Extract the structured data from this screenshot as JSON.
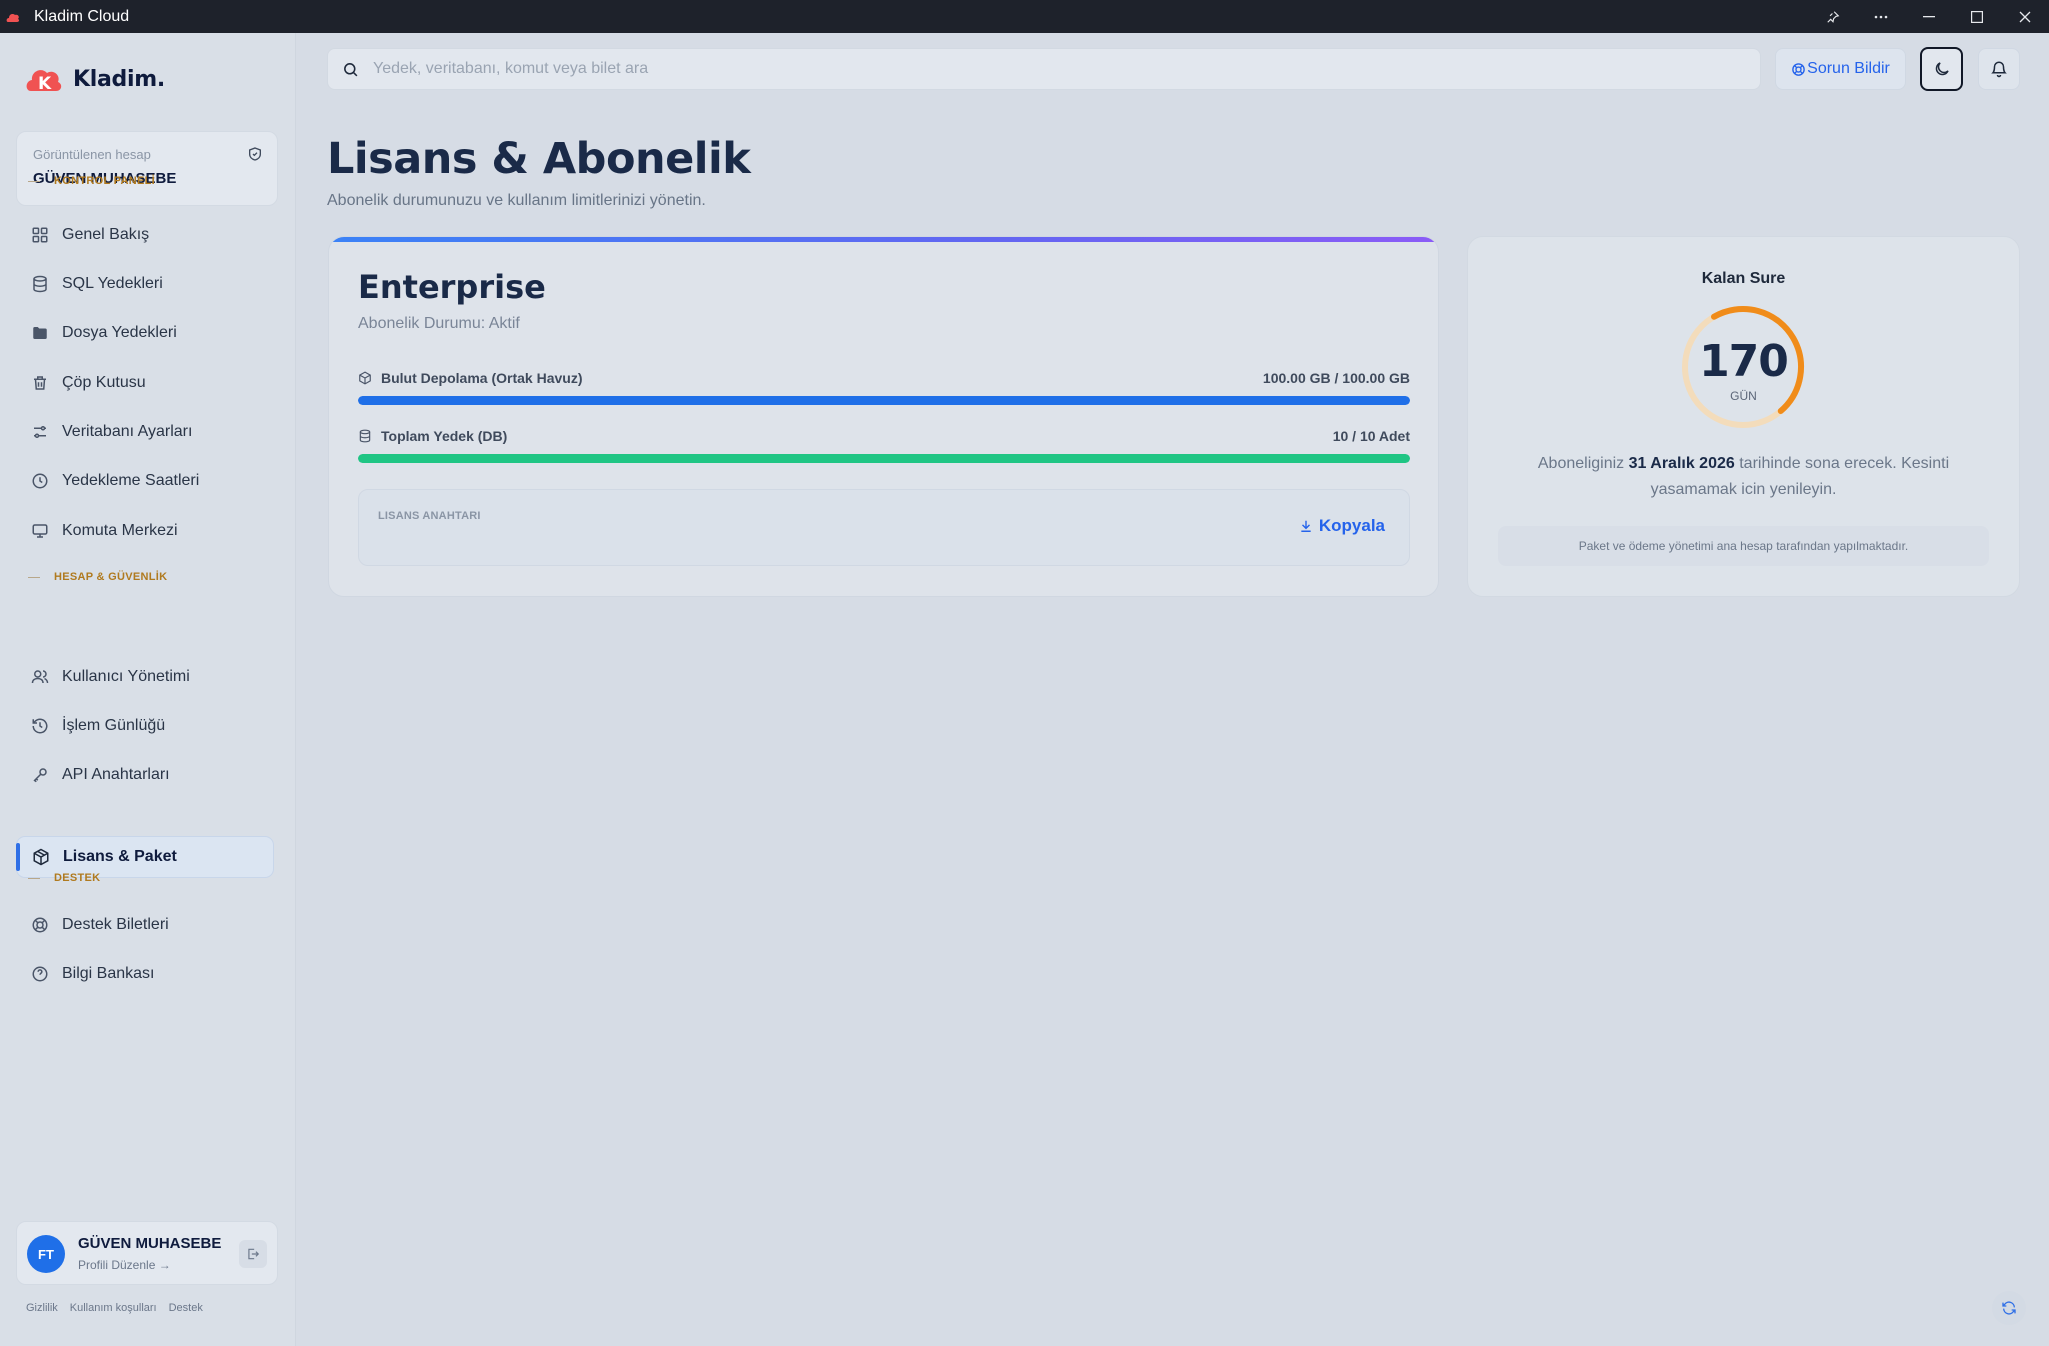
{
  "window": {
    "title": "Kladim Cloud"
  },
  "brand": {
    "name": "Kladim."
  },
  "account": {
    "label": "Görüntülenen hesap",
    "name": "GÜVEN MUHASEBE"
  },
  "sidebar": {
    "sections": [
      {
        "label": "KONTROL PANELİ"
      },
      {
        "label": "HESAP & GÜVENLİK"
      },
      {
        "label": "DESTEK"
      }
    ],
    "items": [
      {
        "label": "Genel Bakış",
        "icon": "grid-icon"
      },
      {
        "label": "SQL Yedekleri",
        "icon": "database-icon"
      },
      {
        "label": "Dosya Yedekleri",
        "icon": "folder-icon"
      },
      {
        "label": "Çöp Kutusu",
        "icon": "trash-icon"
      },
      {
        "label": "Veritabanı Ayarları",
        "icon": "sliders-icon"
      },
      {
        "label": "Yedekleme Saatleri",
        "icon": "clock-icon"
      },
      {
        "label": "Komuta Merkezi",
        "icon": "monitor-icon"
      },
      {
        "label": "Kullanıcı Yönetimi",
        "icon": "users-icon"
      },
      {
        "label": "İşlem Günlüğü",
        "icon": "history-icon"
      },
      {
        "label": "API Anahtarları",
        "icon": "key-icon"
      },
      {
        "label": "Lisans & Paket",
        "icon": "package-icon",
        "active": true
      },
      {
        "label": "Destek Biletleri",
        "icon": "lifebuoy-icon"
      },
      {
        "label": "Bilgi Bankası",
        "icon": "help-circle-icon"
      }
    ]
  },
  "user": {
    "initials": "FT",
    "name": "GÜVEN MUHASEBE",
    "edit_link": "Profili Düzenle →"
  },
  "footer": {
    "links": [
      "Gizlilik",
      "Kullanım koşulları",
      "Destek"
    ]
  },
  "topbar": {
    "search_placeholder": "Yedek, veritabanı, komut veya bilet ara",
    "report_label": "Sorun Bildir"
  },
  "header": {
    "title": "Lisans & Abonelik",
    "subtitle": "Abonelik durumunuzu ve kullanım limitlerinizi yönetin."
  },
  "plan": {
    "name": "Enterprise",
    "status": "Abonelik Durumu: Aktif",
    "quotas": [
      {
        "label": "Bulut Depolama (Ortak Havuz)",
        "value": "100.00 GB / 100.00 GB",
        "fraction": 1.0,
        "color": "#1f6fe8"
      },
      {
        "label": "Toplam Yedek (DB)",
        "value": "10 / 10 Adet",
        "fraction": 1.0,
        "color": "#1fc584"
      }
    ],
    "license_label": "LISANS ANAHTARI",
    "copy_label": "Kopyala"
  },
  "remaining": {
    "title": "Kalan Sure",
    "days": "170",
    "unit": "GÜN",
    "fraction": 0.47,
    "ring_color": "#f08c1a",
    "text_before": "Aboneliginiz",
    "date": "31 Aralık 2026",
    "text_after": "tarihinde sona erecek. Kesinti yasamamak icin yenileyin.",
    "note": "Paket ve ödeme yönetimi ana hesap tarafından yapılmaktadır."
  }
}
